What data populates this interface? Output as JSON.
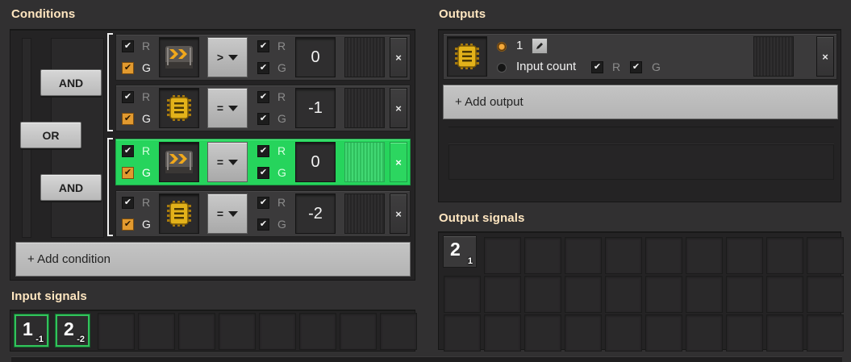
{
  "conditions": {
    "title": "Conditions",
    "logic": {
      "or_label": "OR",
      "and_label_1": "AND",
      "and_label_2": "AND"
    },
    "rows": [
      {
        "signal_icon": "transport-belt-icon",
        "operator": ">",
        "constant": "0",
        "red_in": true,
        "green_in": true,
        "red_out": true,
        "green_out": true,
        "active": false
      },
      {
        "signal_icon": "electronic-circuit-icon",
        "operator": "=",
        "constant": "-1",
        "red_in": true,
        "green_in": true,
        "red_out": true,
        "green_out": true,
        "active": false
      },
      {
        "signal_icon": "transport-belt-icon",
        "operator": "=",
        "constant": "0",
        "red_in": true,
        "green_in": true,
        "red_out": true,
        "green_out": true,
        "active": true
      },
      {
        "signal_icon": "electronic-circuit-icon",
        "operator": "=",
        "constant": "-2",
        "red_in": true,
        "green_in": true,
        "red_out": true,
        "green_out": true,
        "active": false
      }
    ],
    "r_label": "R",
    "g_label": "G",
    "remove_label": "×",
    "add_condition_label": "+ Add condition"
  },
  "input_signals": {
    "title": "Input signals",
    "items": [
      {
        "main": "1",
        "sub": "-1"
      },
      {
        "main": "2",
        "sub": "-2"
      }
    ]
  },
  "outputs": {
    "title": "Outputs",
    "output": {
      "signal_icon": "electronic-circuit-icon",
      "value_label": "1",
      "input_count_label": "Input count",
      "r_label": "R",
      "g_label": "G",
      "remove_label": "×"
    },
    "add_output_label": "+ Add output"
  },
  "output_signals": {
    "title": "Output signals",
    "items": [
      {
        "main": "2",
        "sub": "1"
      }
    ]
  },
  "colors": {
    "accent_green": "#26d45c",
    "checkbox_orange": "#e29a2f",
    "title_color": "#ffe6c0"
  }
}
